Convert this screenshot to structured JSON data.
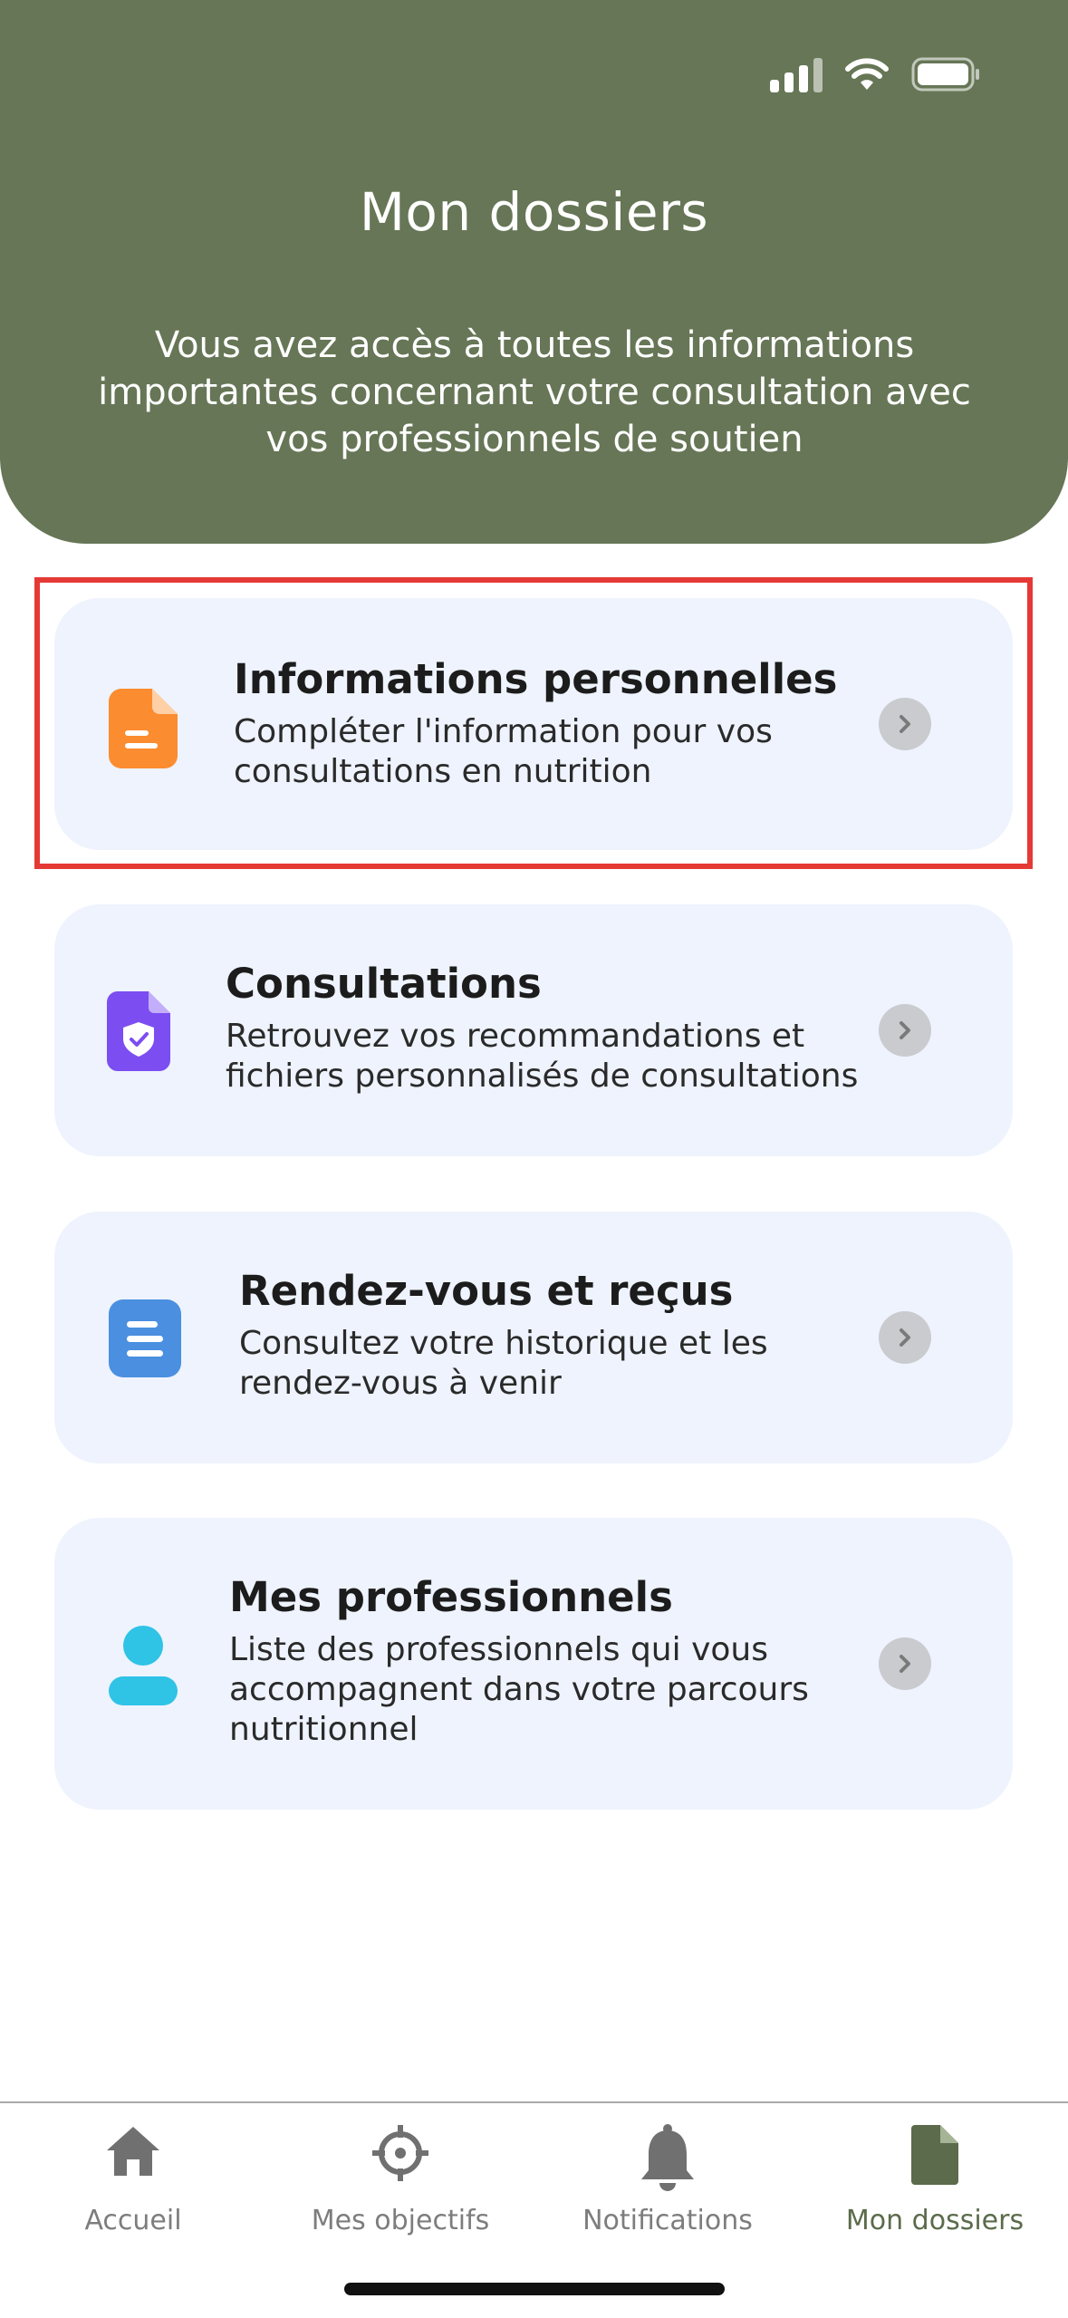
{
  "header": {
    "title": "Mon dossiers",
    "subtitle": "Vous avez accès à toutes les informations importantes concernant votre consultation avec vos professionnels de soutien",
    "background_color": "#667656"
  },
  "cards": [
    {
      "title": "Informations personnelles",
      "description": "Compléter l'information pour vos consultations en nutrition",
      "icon": "document-icon",
      "color": "#fb8c2f"
    },
    {
      "title": "Consultations",
      "description": "Retrouvez vos recommandations et fichiers personnalisés de consultations",
      "icon": "shield-document-icon",
      "color": "#7c4df1"
    },
    {
      "title": "Rendez-vous et reçus",
      "description": "Consultez votre historique et les rendez-vous à venir",
      "icon": "list-document-icon",
      "color": "#4a8fe0"
    },
    {
      "title": "Mes professionnels",
      "description": "Liste des professionnels qui vous accompagnent dans votre parcours nutritionnel",
      "icon": "user-icon",
      "color": "#2fc3e6"
    }
  ],
  "tabs": [
    {
      "label": "Accueil",
      "icon": "home-icon",
      "active": false
    },
    {
      "label": "Mes objectifs",
      "icon": "target-icon",
      "active": false
    },
    {
      "label": "Notifications",
      "icon": "bell-icon",
      "active": false
    },
    {
      "label": "Mon dossiers",
      "icon": "file-icon",
      "active": true
    }
  ],
  "colors": {
    "highlight_border": "#e53935",
    "card_bg": "#eef3fd",
    "active_tab": "#5b6b4b",
    "inactive_tab": "#7d7d7d"
  }
}
